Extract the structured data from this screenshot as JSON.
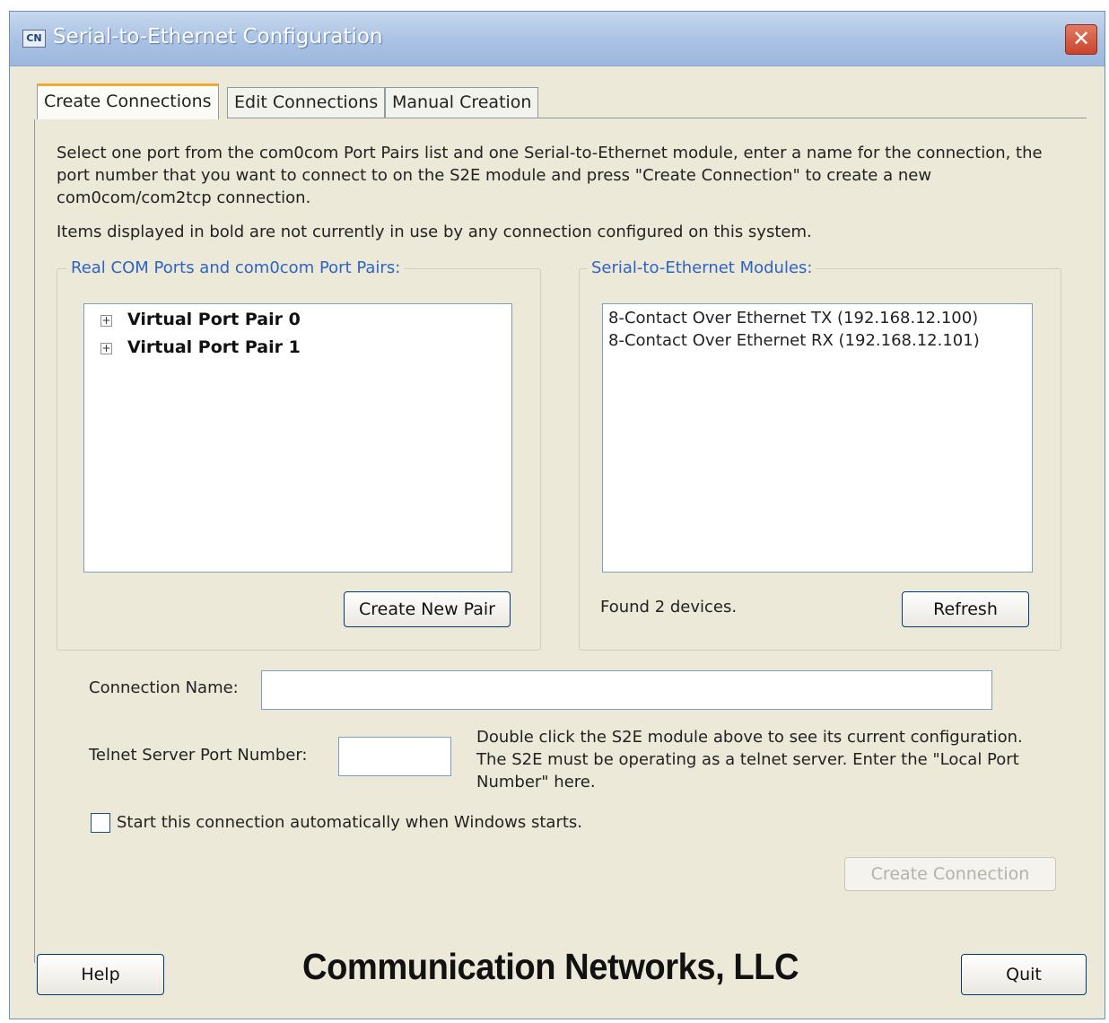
{
  "window": {
    "title": "Serial-to-Ethernet Configuration",
    "icon_text": "CN",
    "close_glyph": "✕"
  },
  "tabs": [
    {
      "label": "Create Connections",
      "active": true
    },
    {
      "label": "Edit Connections",
      "active": false
    },
    {
      "label": "Manual Creation",
      "active": false
    }
  ],
  "instructions": {
    "para1": "Select one port from the com0com Port Pairs list and one Serial-to-Ethernet module, enter a name for the connection, the port number that you want to connect to on the S2E module and press \"Create Connection\" to create a new com0com/com2tcp connection.",
    "para2": "Items displayed in bold are not currently in use by any connection configured on this system."
  },
  "ports_group": {
    "label": "Real COM Ports and com0com Port Pairs:",
    "items": [
      {
        "label": "Virtual Port Pair 0",
        "expander": "+"
      },
      {
        "label": "Virtual Port Pair 1",
        "expander": "+"
      }
    ],
    "create_pair_button": "Create New Pair"
  },
  "modules_group": {
    "label": "Serial-to-Ethernet Modules:",
    "items": [
      "8-Contact Over Ethernet TX (192.168.12.100)",
      "8-Contact Over Ethernet RX (192.168.12.101)"
    ],
    "status": "Found 2 devices.",
    "refresh_button": "Refresh"
  },
  "form": {
    "connection_name_label": "Connection Name:",
    "connection_name_value": "",
    "telnet_port_label": "Telnet Server Port Number:",
    "telnet_port_value": "",
    "telnet_help": "Double click the S2E module above to see its current configuration. The S2E must be operating as a telnet server. Enter the \"Local Port Number\" here.",
    "autostart_label": "Start this connection automatically when Windows starts.",
    "autostart_checked": false,
    "create_connection_button": "Create Connection"
  },
  "footer": {
    "help_button": "Help",
    "brand": "Communication Networks, LLC",
    "quit_button": "Quit"
  }
}
